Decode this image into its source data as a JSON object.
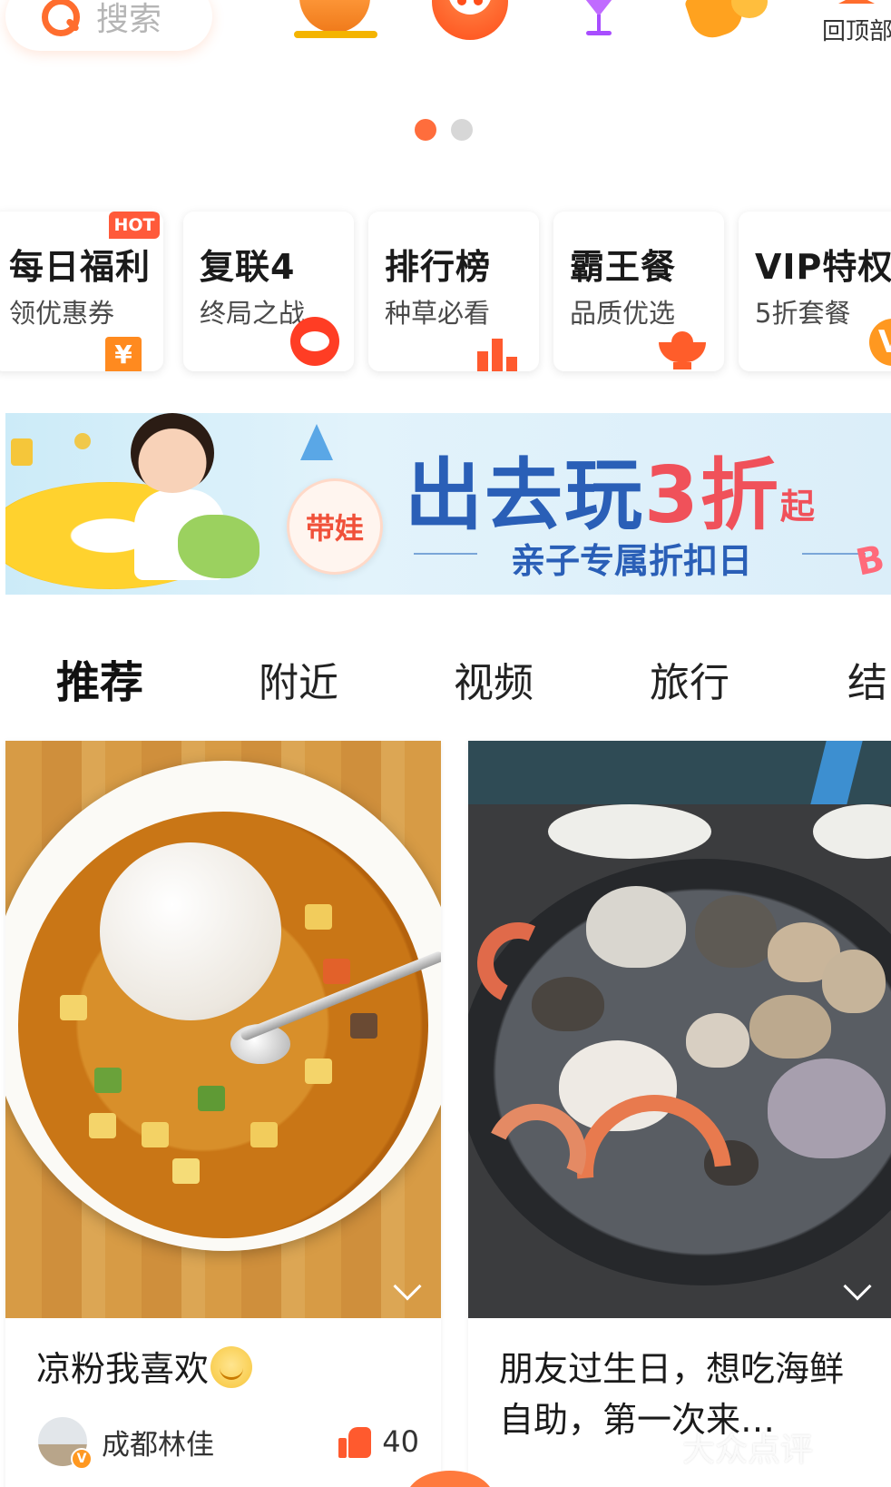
{
  "search": {
    "placeholder_text": "搜索",
    "icon": "search-icon"
  },
  "top_icons": [
    {
      "name": "roast-chicken-icon"
    },
    {
      "name": "cat-mascot-icon"
    },
    {
      "name": "cocktail-icon"
    },
    {
      "name": "fan-icon"
    }
  ],
  "back_to_top": {
    "label": "回顶部",
    "icon": "arrow-up-icon"
  },
  "carousel": {
    "pages": 2,
    "active_index": 0
  },
  "promo_cards": [
    {
      "title": "每日福利",
      "subtitle": "领优惠券",
      "badge": "HOT",
      "icon": "coupon-icon"
    },
    {
      "title": "复联4",
      "subtitle": "终局之战",
      "icon": "cat-face-icon"
    },
    {
      "title": "排行榜",
      "subtitle": "种草必看",
      "icon": "bar-chart-icon"
    },
    {
      "title": "霸王餐",
      "subtitle": "品质优选",
      "icon": "hotpot-icon"
    },
    {
      "title": "VIP特权",
      "subtitle": "5折套餐",
      "icon": "vip-badge-icon",
      "icon_text": "V"
    }
  ],
  "banner": {
    "tag": "带娃",
    "headline_main": "出去玩",
    "headline_number": "3折",
    "headline_suffix": "起",
    "subline": "亲子专属折扣日"
  },
  "tabs": [
    {
      "label": "推荐",
      "active": true
    },
    {
      "label": "附近",
      "active": false
    },
    {
      "label": "视频",
      "active": false
    },
    {
      "label": "旅行",
      "active": false
    },
    {
      "label": "结",
      "active": false
    }
  ],
  "feed": [
    {
      "caption": "凉粉我喜欢",
      "author": "成都林佳",
      "likes": "40",
      "avatar_badge": "V"
    },
    {
      "caption": "朋友过生日，想吃海鲜自助，第一次来…"
    }
  ],
  "watermark": "大众点评",
  "colors": {
    "accent": "#ff6d2e",
    "banner_blue": "#2a5fb7",
    "banner_pink": "#f0515a"
  }
}
